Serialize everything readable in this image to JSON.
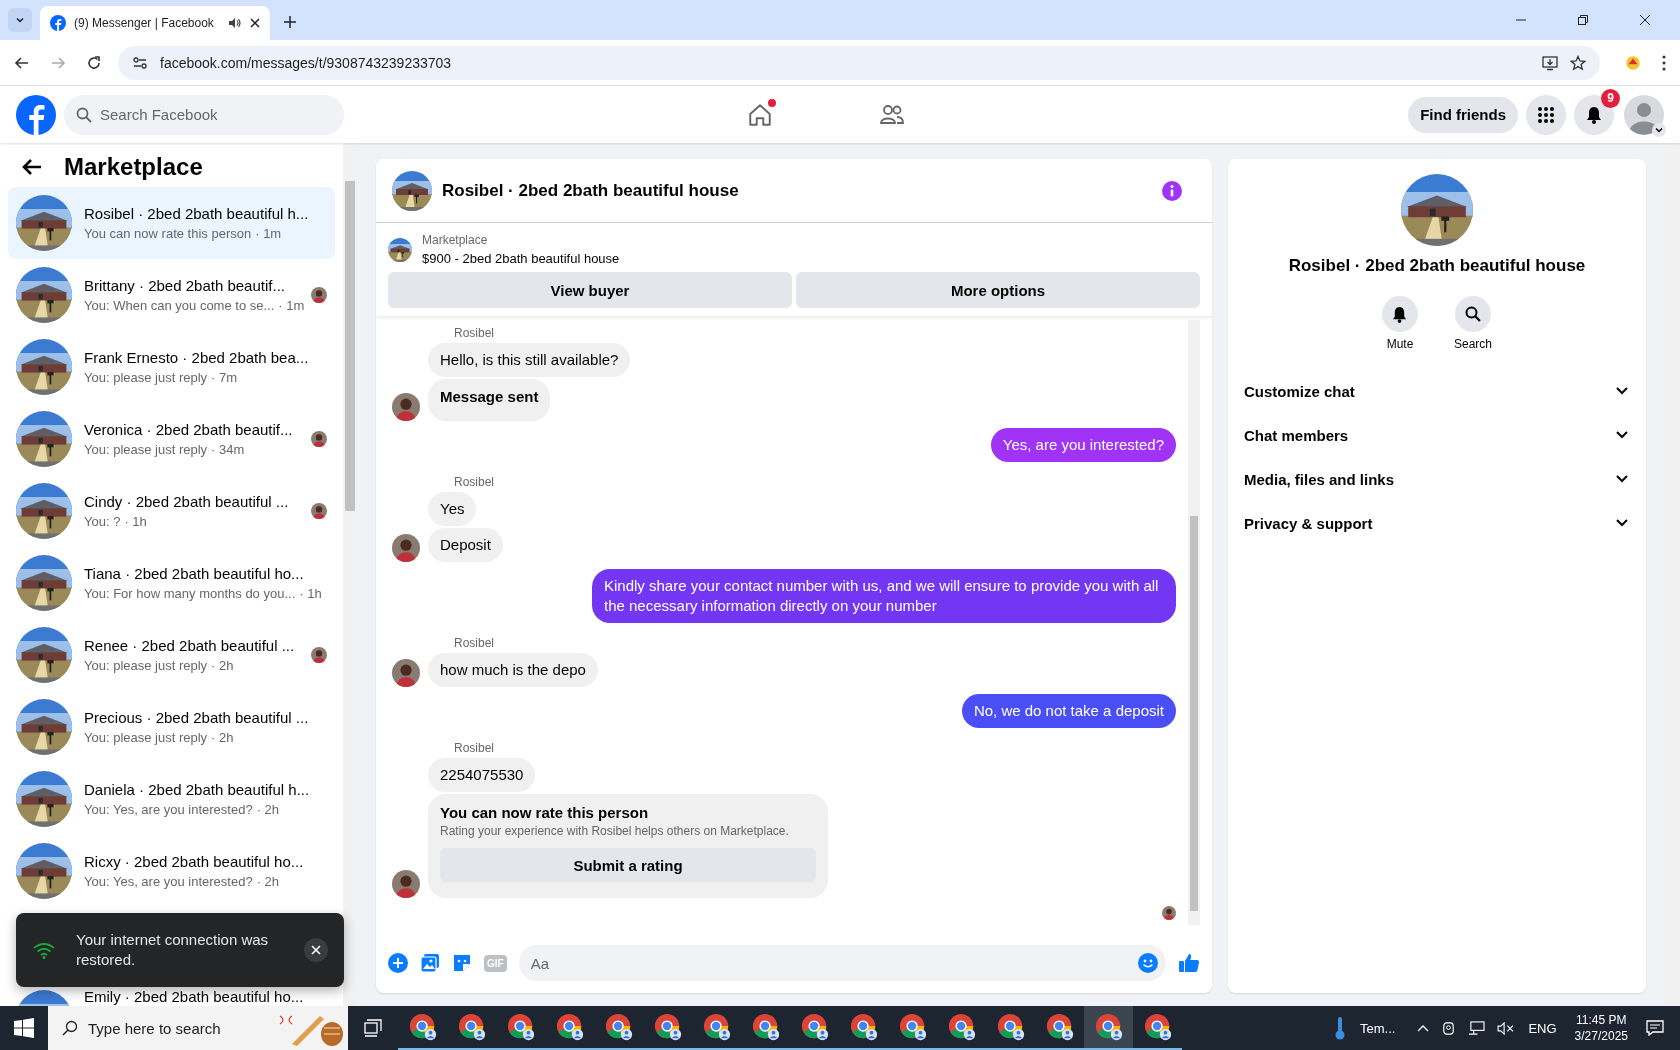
{
  "browser": {
    "tabs": [
      {
        "title": "(9) Messenger | Facebook",
        "selected": true
      }
    ],
    "url": "facebook.com/messages/t/9308743239233703"
  },
  "header": {
    "search": {
      "placeholder": "Search Facebook"
    },
    "find_friends": "Find friends",
    "notifications_badge": "9"
  },
  "sidebar": {
    "title": "Marketplace",
    "conversations": [
      {
        "name": "Rosibel · 2bed 2bath beautiful h...",
        "preview": "You can now rate this person",
        "time": "· 1m",
        "selected": true,
        "seen": false
      },
      {
        "name": "Brittany · 2bed 2bath beautif...",
        "preview": "You: When can you come to se...",
        "time": "· 1m",
        "selected": false,
        "seen": true
      },
      {
        "name": "Frank Ernesto · 2bed 2bath bea...",
        "preview": "You: please just reply",
        "time": "· 7m",
        "selected": false,
        "seen": false
      },
      {
        "name": "Veronica · 2bed 2bath beautif...",
        "preview": "You: please just reply",
        "time": "· 34m",
        "selected": false,
        "seen": true
      },
      {
        "name": "Cindy · 2bed 2bath beautiful ...",
        "preview": "You: ?",
        "time": "· 1h",
        "selected": false,
        "seen": true
      },
      {
        "name": "Tiana · 2bed 2bath beautiful ho...",
        "preview": "You: For how many months do you...",
        "time": "· 1h",
        "selected": false,
        "seen": false
      },
      {
        "name": "Renee · 2bed 2bath beautiful ...",
        "preview": "You: please just reply",
        "time": "· 2h",
        "selected": false,
        "seen": true
      },
      {
        "name": "Precious · 2bed 2bath beautiful ...",
        "preview": "You: please just reply",
        "time": "· 2h",
        "selected": false,
        "seen": false
      },
      {
        "name": "Daniela · 2bed 2bath beautiful h...",
        "preview": "You: Yes, are you interested?",
        "time": "· 2h",
        "selected": false,
        "seen": false
      },
      {
        "name": "Ricxy · 2bed 2bath beautiful ho...",
        "preview": "You: Yes, are you interested?",
        "time": "· 2h",
        "selected": false,
        "seen": false
      },
      {
        "name": "Emily · 2bed 2bath beautiful ho...",
        "selected": false,
        "seen": false
      }
    ]
  },
  "toast": {
    "message": "Your internet connection was restored."
  },
  "chat": {
    "title": "Rosibel · 2bed 2bath beautiful house",
    "listing": {
      "source": "Marketplace",
      "summary": "$900 - 2bed 2bath beautiful house"
    },
    "actions": [
      "View buyer",
      "More options"
    ],
    "messages": [
      {
        "kind": "sender",
        "text": "Rosibel"
      },
      {
        "kind": "in",
        "text": "Hello, is this still available?",
        "avatar": false
      },
      {
        "kind": "notice",
        "text": "Message sent",
        "avatar": true
      },
      {
        "kind": "out",
        "text": "Yes, are you interested?",
        "color": "#a033f5"
      },
      {
        "kind": "sender",
        "text": "Rosibel"
      },
      {
        "kind": "in",
        "text": "Yes",
        "avatar": false
      },
      {
        "kind": "in",
        "text": "Deposit",
        "avatar": true
      },
      {
        "kind": "out",
        "text": "Kindly share your contact number with us, and we will ensure to provide you with all the necessary information directly on your number",
        "color": "#7337f4"
      },
      {
        "kind": "sender",
        "text": "Rosibel"
      },
      {
        "kind": "in",
        "text": "how much is the depo",
        "avatar": true
      },
      {
        "kind": "out",
        "text": "No, we do not take a deposit",
        "color": "#4a4ef5"
      },
      {
        "kind": "sender",
        "text": "Rosibel"
      },
      {
        "kind": "in",
        "text": "2254075530",
        "avatar": false
      },
      {
        "kind": "rating",
        "title": "You can now rate this person",
        "text": "Rating your experience with Rosibel helps others on Marketplace.",
        "button": "Submit a rating",
        "avatar": true
      }
    ],
    "composer": {
      "gif": "GIF",
      "placeholder": "Aa"
    }
  },
  "details": {
    "title": "Rosibel · 2bed 2bath beautiful house",
    "actions": [
      {
        "kind": "mute",
        "label": "Mute"
      },
      {
        "kind": "search",
        "label": "Search"
      }
    ],
    "sections": [
      {
        "label": "Customize chat",
        "expanded": false
      },
      {
        "label": "Chat members",
        "expanded": false
      },
      {
        "label": "Media, files and links",
        "expanded": false
      },
      {
        "label": "Privacy & support",
        "expanded": false
      }
    ]
  },
  "taskbar": {
    "search": {
      "placeholder": "Type here to search"
    },
    "apps": [
      {
        "selected": false
      },
      {
        "selected": false
      },
      {
        "selected": false
      },
      {
        "selected": false
      },
      {
        "selected": false
      },
      {
        "selected": false
      },
      {
        "selected": false
      },
      {
        "selected": false
      },
      {
        "selected": false
      },
      {
        "selected": false
      },
      {
        "selected": false
      },
      {
        "selected": false
      },
      {
        "selected": false
      },
      {
        "selected": false
      },
      {
        "selected": true
      },
      {
        "selected": false
      }
    ],
    "weather": "Tem...",
    "language": "ENG",
    "time": "11:45 PM",
    "date": "3/27/2025"
  }
}
